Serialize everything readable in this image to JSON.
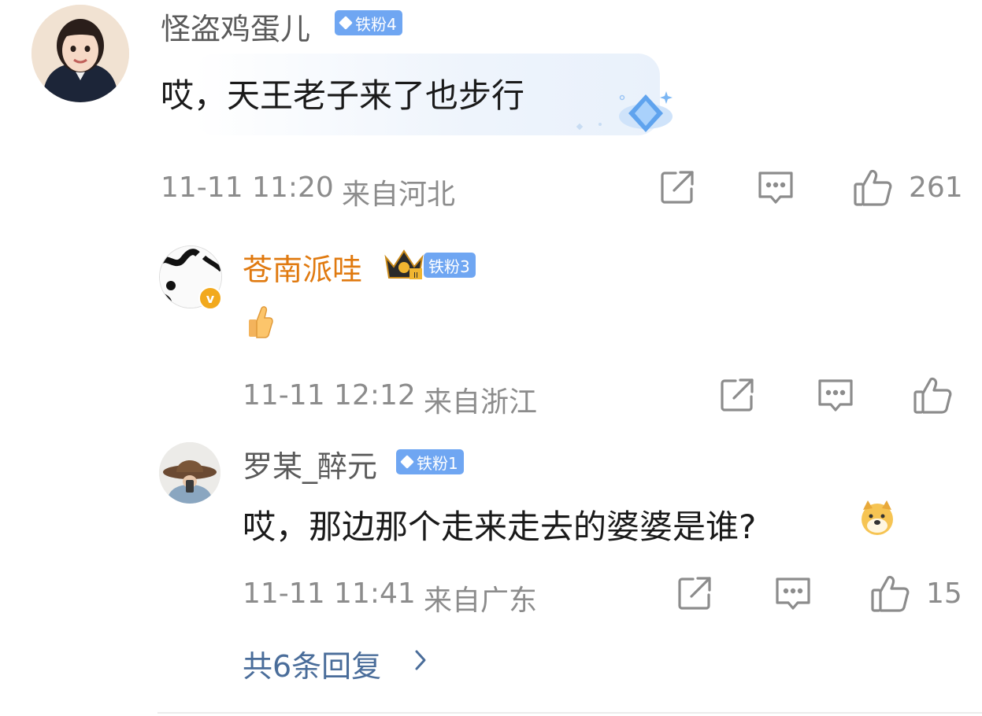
{
  "comment": {
    "username": "怪盗鸡蛋儿",
    "badge": "铁粉4",
    "text": "哎，天王老子来了也步行",
    "time": "11-11 11:20",
    "location": "来自河北",
    "like_count": "261",
    "avatar_icon": "girl-portrait"
  },
  "replies": [
    {
      "username": "苍南派哇",
      "badge": "铁粉3",
      "text_icon": "thumbs-up-emoji",
      "time": "11-11 12:12",
      "location": "来自浙江",
      "like_count": "",
      "verified": true,
      "crown_badge": "crown-icon"
    },
    {
      "username": "罗某_醉元",
      "badge": "铁粉1",
      "text": "哎，那边那个走来走去的婆婆是谁?",
      "time": "11-11 11:41",
      "location": "来自广东",
      "like_count": "15"
    }
  ],
  "more_replies": {
    "label": "共6条回复"
  },
  "colors": {
    "badge_blue": "#6fa6f2",
    "vip_orange": "#e07a10",
    "link_blue": "#4a6d9a",
    "meta_gray": "#8c8c8c"
  }
}
